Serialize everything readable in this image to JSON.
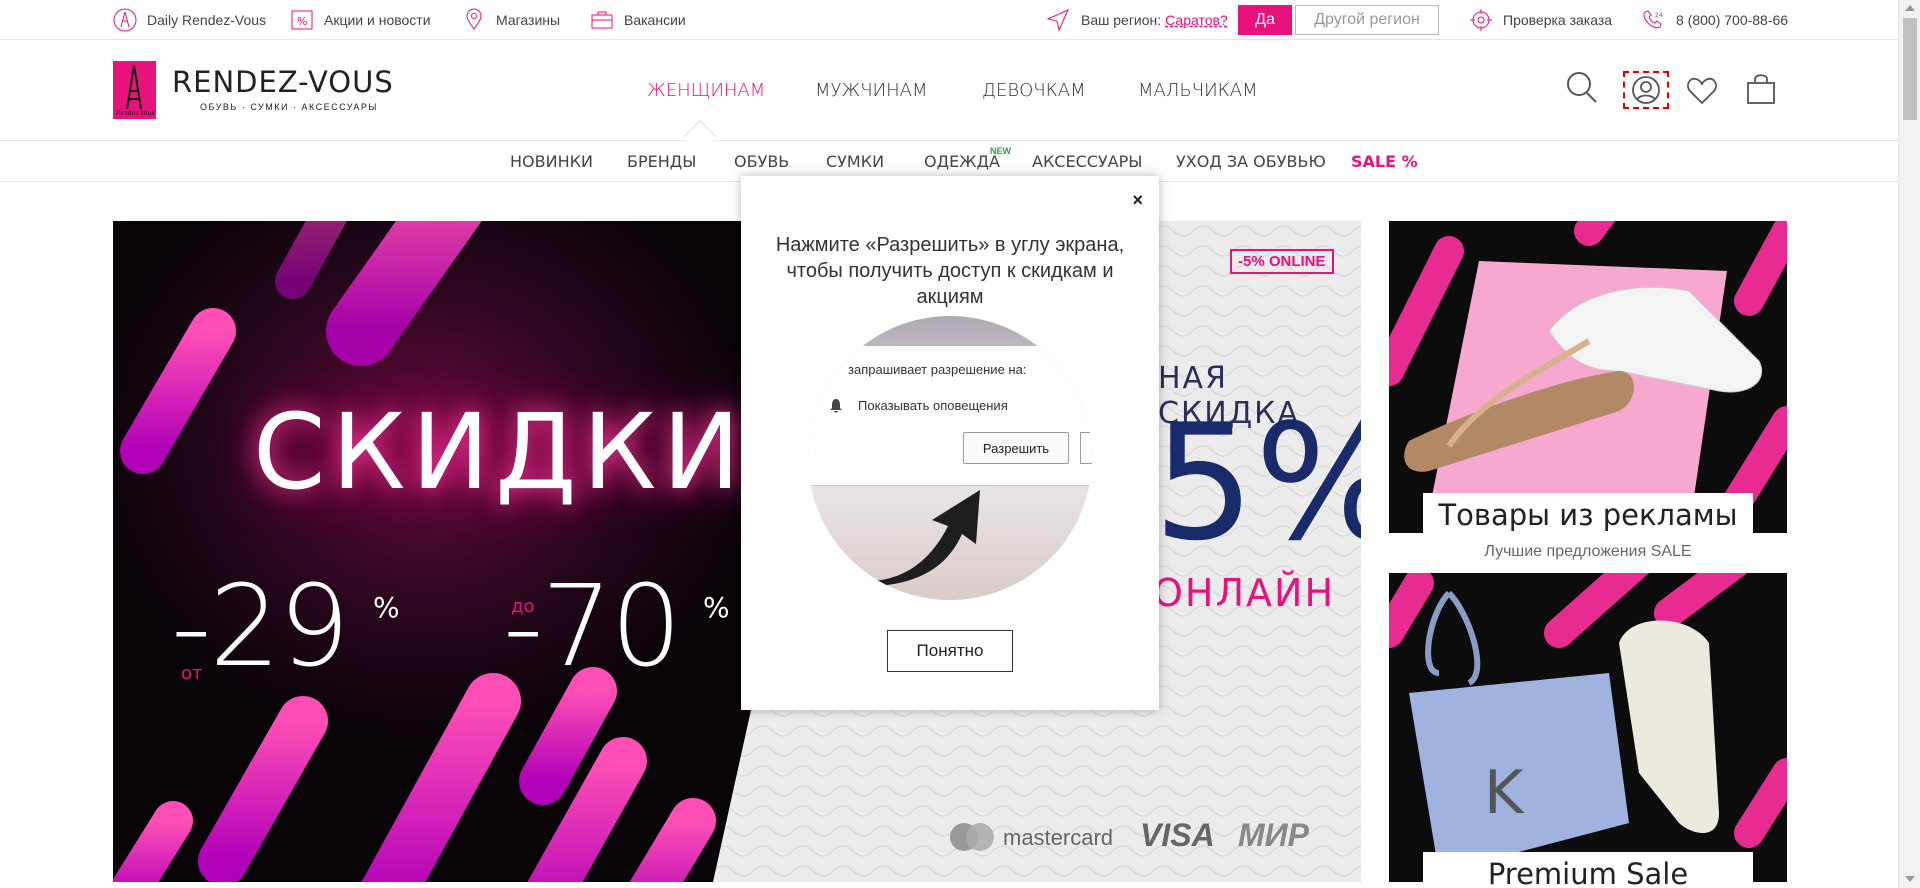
{
  "topbar": {
    "daily": "Daily Rendez-Vous",
    "promos": "Акции и новости",
    "stores": "Магазины",
    "vacancies": "Вакансии",
    "region_label": "Ваш регион:",
    "region_value": "Саратов?",
    "yes": "Да",
    "other_region": "Другой регион",
    "order_check": "Проверка заказа",
    "phone": "8 (800) 700-88-66"
  },
  "logo": {
    "name": "RENDEZ-VOUS",
    "tagline": "ОБУВЬ · СУМКИ · АКСЕССУАРЫ",
    "mark": "Rendez-Vous"
  },
  "main_nav": [
    "ЖЕНЩИНАМ",
    "МУЖЧИНАМ",
    "ДЕВОЧКАМ",
    "МАЛЬЧИКАМ"
  ],
  "sub_nav": [
    "НОВИНКИ",
    "БРЕНДЫ",
    "ОБУВЬ",
    "СУМКИ",
    "ОДЕЖДА",
    "АКСЕССУАРЫ",
    "УХОД ЗА ОБУВЬЮ",
    "SALE %"
  ],
  "new_badge": "NEW",
  "banner": {
    "headline": "СКИДКИ",
    "from_label": "от",
    "from_value": "-29",
    "to_label": "до",
    "to_value": "-70",
    "percent": "%",
    "online_badge": "-5% ONLINE",
    "right_line1": "НАЯ СКИДКА",
    "right_line2": "5%",
    "right_line3": "ОНЛАЙН",
    "payments": [
      "mastercard",
      "VISA",
      "МИР"
    ]
  },
  "promos": [
    {
      "title": "Товары из рекламы",
      "subtitle": "Лучшие предложения SALE"
    },
    {
      "title": "Premium Sale",
      "subtitle": ""
    }
  ],
  "popup": {
    "close": "×",
    "text": "Нажмите «Разрешить» в углу экрана, чтобы получить доступ к скидкам и акциям",
    "perm_request": "запрашивает разрешение на:",
    "perm_item": "Показывать оповещения",
    "allow": "Разрешить",
    "ok": "Понятно"
  },
  "colors": {
    "brand": "#e8127c",
    "navy": "#1a2b6b"
  },
  "icons": [
    "eiffel-icon",
    "percent-tag-icon",
    "map-pin-icon",
    "briefcase-icon",
    "location-arrow-icon",
    "target-icon",
    "phone-24-icon",
    "search-icon",
    "user-icon",
    "heart-icon",
    "bag-icon",
    "bell-icon"
  ]
}
